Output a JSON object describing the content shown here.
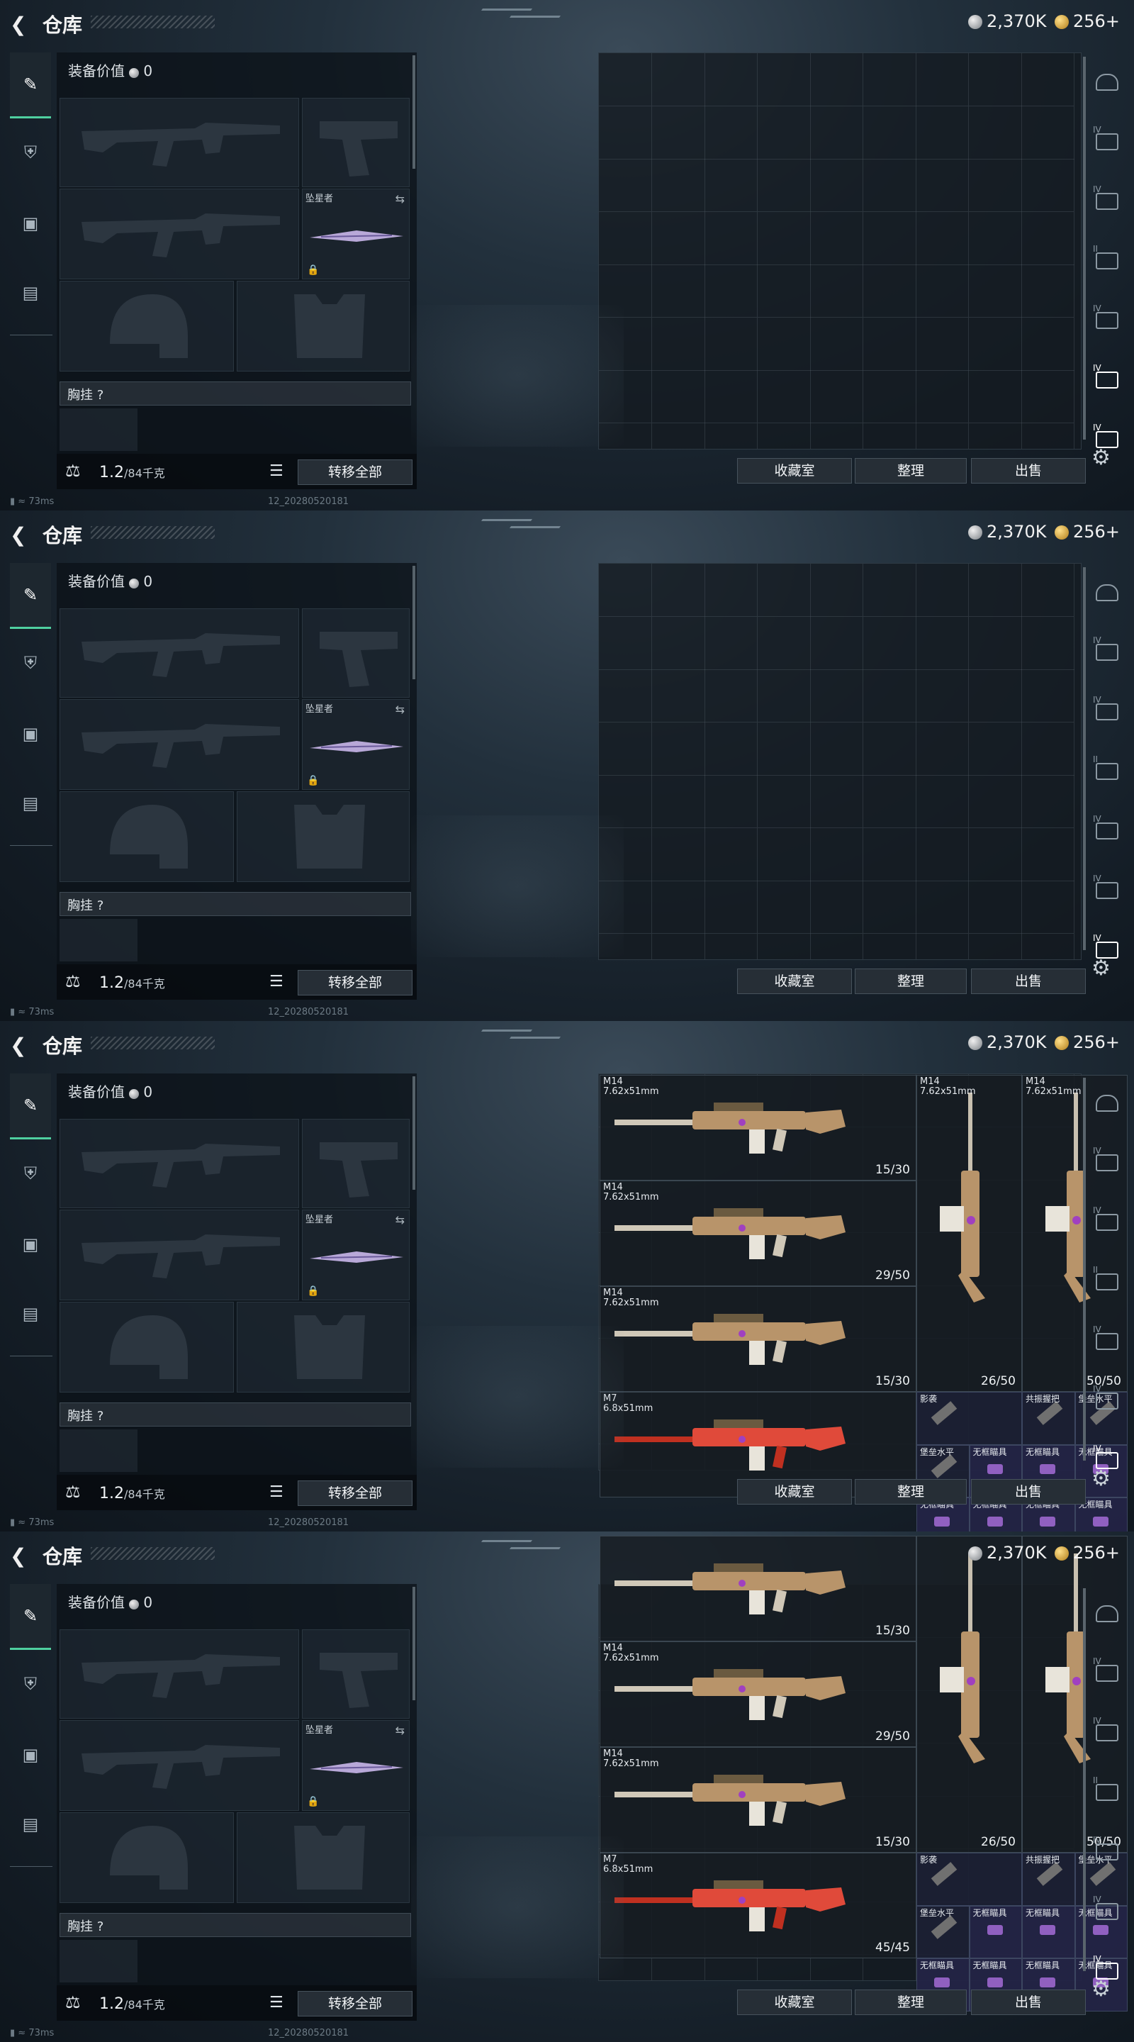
{
  "title": "仓库",
  "currency": {
    "silver": "2,370K",
    "gold": "256+"
  },
  "left_panel": {
    "equipment_value_label": "装备价值",
    "equipment_value": "0",
    "melee_label": "坠星者",
    "chest_rig_label": "胸挂 ?",
    "weight": "1.2",
    "weight_max": "/84千克",
    "transfer_all": "转移全部"
  },
  "bottom_buttons": {
    "collection": "收藏室",
    "organize": "整理",
    "sell": "出售"
  },
  "status": {
    "ping": "73ms",
    "build": "12_20280520181"
  },
  "frames": [
    {
      "items": []
    },
    {
      "items": []
    },
    {
      "items": [
        {
          "name": "M14\n7.62x51mm",
          "ammo": "15/30",
          "kind": "rifle-h"
        },
        {
          "name": "M14\n7.62x51mm",
          "ammo": "29/50",
          "kind": "rifle-h"
        },
        {
          "name": "M14\n7.62x51mm",
          "ammo": "15/30",
          "kind": "rifle-h"
        },
        {
          "name": "M7\n6.8x51mm",
          "ammo": "",
          "kind": "rifle-red"
        },
        {
          "name": "M14\n7.62x51mm",
          "ammo": "26/50",
          "kind": "rifle-v"
        },
        {
          "name": "M14\n7.62x51mm",
          "ammo": "50/50",
          "kind": "rifle-v"
        },
        {
          "name": "影袭",
          "ammo": "",
          "kind": "stock"
        },
        {
          "name": "共振握把",
          "ammo": "",
          "kind": "grip"
        },
        {
          "name": "堡垒水平",
          "ammo": "",
          "kind": "mod"
        },
        {
          "name": "堡垒水平",
          "ammo": "",
          "kind": "mod"
        },
        {
          "name": "无框瞄具",
          "ammo": "",
          "kind": "sight"
        },
        {
          "name": "无框瞄具",
          "ammo": "",
          "kind": "sight"
        },
        {
          "name": "无框瞄具",
          "ammo": "",
          "kind": "sight"
        },
        {
          "name": "无框瞄具",
          "ammo": "",
          "kind": "sight"
        },
        {
          "name": "无框瞄具",
          "ammo": "",
          "kind": "sight"
        },
        {
          "name": "无框瞄具",
          "ammo": "",
          "kind": "sight"
        },
        {
          "name": "无框瞄具",
          "ammo": "",
          "kind": "sight"
        }
      ]
    },
    {
      "items": [
        {
          "name": "",
          "ammo": "15/30",
          "kind": "rifle-h"
        },
        {
          "name": "M14\n7.62x51mm",
          "ammo": "29/50",
          "kind": "rifle-h"
        },
        {
          "name": "M14\n7.62x51mm",
          "ammo": "15/30",
          "kind": "rifle-h"
        },
        {
          "name": "M7\n6.8x51mm",
          "ammo": "45/45",
          "kind": "rifle-red"
        },
        {
          "name": "",
          "ammo": "26/50",
          "kind": "rifle-v"
        },
        {
          "name": "",
          "ammo": "50/50",
          "kind": "rifle-v"
        },
        {
          "name": "影袭",
          "ammo": "",
          "kind": "stock"
        },
        {
          "name": "共振握把",
          "ammo": "",
          "kind": "grip"
        },
        {
          "name": "堡垒水平",
          "ammo": "",
          "kind": "mod"
        },
        {
          "name": "堡垒水平",
          "ammo": "",
          "kind": "mod"
        },
        {
          "name": "无框瞄具",
          "ammo": "",
          "kind": "sight"
        },
        {
          "name": "无框瞄具",
          "ammo": "",
          "kind": "sight"
        },
        {
          "name": "无框瞄具",
          "ammo": "",
          "kind": "sight"
        },
        {
          "name": "无框瞄具",
          "ammo": "",
          "kind": "sight"
        },
        {
          "name": "无框瞄具",
          "ammo": "",
          "kind": "sight"
        },
        {
          "name": "无框瞄具",
          "ammo": "",
          "kind": "sight"
        },
        {
          "name": "无框瞄具",
          "ammo": "",
          "kind": "sight"
        }
      ]
    }
  ],
  "icons": {
    "back": "back-arrow-icon",
    "weapon_tab": "pistol-icon",
    "armor_tab": "armor-icon",
    "backpack_tab": "backpack-icon",
    "case_tab": "briefcase-icon",
    "lock": "lock-icon",
    "list": "list-icon",
    "swap": "swap-icon",
    "settings": "gear-icon"
  },
  "colors": {
    "accent": "#4fd0a0",
    "gold": "#d8a030",
    "rifle_red": "#e04a3a"
  }
}
